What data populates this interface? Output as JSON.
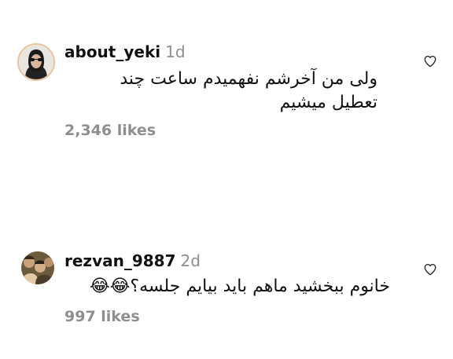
{
  "comments": [
    {
      "username": "about_yeki",
      "time": "1d",
      "text": "ولی من آخرشم نفهمیدم ساعت چند تعطیل میشیم",
      "likes": "2,346 likes",
      "avatar_icon": "profile-photo-woman-sunglasses",
      "like_icon": "heart-outline-icon"
    },
    {
      "username": "rezvan_9887",
      "time": "2d",
      "text": "خانوم ببخشید ماهم باید بیایم جلسه؟😂😂",
      "likes": "997 likes",
      "avatar_icon": "profile-photo-group-selfie",
      "like_icon": "heart-outline-icon"
    }
  ],
  "colors": {
    "text": "#111111",
    "muted": "#8e8e8e",
    "story_ring": "#c13584"
  }
}
